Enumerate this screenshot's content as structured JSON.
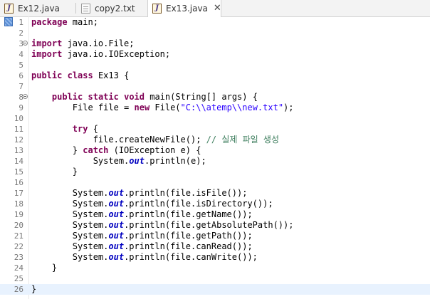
{
  "tabs": [
    {
      "label": "Ex12.java",
      "type": "java",
      "active": false
    },
    {
      "label": "copy2.txt",
      "type": "text",
      "active": false
    },
    {
      "label": "Ex13.java",
      "type": "java",
      "active": true
    }
  ],
  "close_glyph": "✕",
  "java_icon_glyph": "J",
  "code_lines": [
    {
      "n": "1",
      "tokens": [
        {
          "t": "kw",
          "v": "package"
        },
        {
          "t": "",
          "v": " main;"
        }
      ]
    },
    {
      "n": "2",
      "tokens": []
    },
    {
      "n": "3",
      "fold": true,
      "tokens": [
        {
          "t": "kw",
          "v": "import"
        },
        {
          "t": "",
          "v": " java.io.File;"
        }
      ]
    },
    {
      "n": "4",
      "tokens": [
        {
          "t": "kw",
          "v": "import"
        },
        {
          "t": "",
          "v": " java.io.IOException;"
        }
      ]
    },
    {
      "n": "5",
      "tokens": []
    },
    {
      "n": "6",
      "tokens": [
        {
          "t": "kw",
          "v": "public"
        },
        {
          "t": "",
          "v": " "
        },
        {
          "t": "kw",
          "v": "class"
        },
        {
          "t": "",
          "v": " Ex13 {"
        }
      ]
    },
    {
      "n": "7",
      "tokens": []
    },
    {
      "n": "8",
      "fold": true,
      "tokens": [
        {
          "t": "",
          "v": "    "
        },
        {
          "t": "kw",
          "v": "public"
        },
        {
          "t": "",
          "v": " "
        },
        {
          "t": "kw",
          "v": "static"
        },
        {
          "t": "",
          "v": " "
        },
        {
          "t": "kw",
          "v": "void"
        },
        {
          "t": "",
          "v": " main(String[] args) {"
        }
      ]
    },
    {
      "n": "9",
      "tokens": [
        {
          "t": "",
          "v": "        File file = "
        },
        {
          "t": "kw",
          "v": "new"
        },
        {
          "t": "",
          "v": " File("
        },
        {
          "t": "st",
          "v": "\"C:\\\\atemp\\\\new.txt\""
        },
        {
          "t": "",
          "v": ");"
        }
      ]
    },
    {
      "n": "10",
      "tokens": []
    },
    {
      "n": "11",
      "tokens": [
        {
          "t": "",
          "v": "        "
        },
        {
          "t": "kw",
          "v": "try"
        },
        {
          "t": "",
          "v": " {"
        }
      ]
    },
    {
      "n": "12",
      "tokens": [
        {
          "t": "",
          "v": "            file.createNewFile(); "
        },
        {
          "t": "cm",
          "v": "// 실제 파일 생성"
        }
      ]
    },
    {
      "n": "13",
      "tokens": [
        {
          "t": "",
          "v": "        } "
        },
        {
          "t": "kw",
          "v": "catch"
        },
        {
          "t": "",
          "v": " (IOException e) {"
        }
      ]
    },
    {
      "n": "14",
      "tokens": [
        {
          "t": "",
          "v": "            System."
        },
        {
          "t": "fd",
          "v": "out"
        },
        {
          "t": "",
          "v": ".println(e);"
        }
      ]
    },
    {
      "n": "15",
      "tokens": [
        {
          "t": "",
          "v": "        }"
        }
      ]
    },
    {
      "n": "16",
      "tokens": []
    },
    {
      "n": "17",
      "tokens": [
        {
          "t": "",
          "v": "        System."
        },
        {
          "t": "fd",
          "v": "out"
        },
        {
          "t": "",
          "v": ".println(file.isFile());"
        }
      ]
    },
    {
      "n": "18",
      "tokens": [
        {
          "t": "",
          "v": "        System."
        },
        {
          "t": "fd",
          "v": "out"
        },
        {
          "t": "",
          "v": ".println(file.isDirectory());"
        }
      ]
    },
    {
      "n": "19",
      "tokens": [
        {
          "t": "",
          "v": "        System."
        },
        {
          "t": "fd",
          "v": "out"
        },
        {
          "t": "",
          "v": ".println(file.getName());"
        }
      ]
    },
    {
      "n": "20",
      "tokens": [
        {
          "t": "",
          "v": "        System."
        },
        {
          "t": "fd",
          "v": "out"
        },
        {
          "t": "",
          "v": ".println(file.getAbsolutePath());"
        }
      ]
    },
    {
      "n": "21",
      "tokens": [
        {
          "t": "",
          "v": "        System."
        },
        {
          "t": "fd",
          "v": "out"
        },
        {
          "t": "",
          "v": ".println(file.getPath());"
        }
      ]
    },
    {
      "n": "22",
      "tokens": [
        {
          "t": "",
          "v": "        System."
        },
        {
          "t": "fd",
          "v": "out"
        },
        {
          "t": "",
          "v": ".println(file.canRead());"
        }
      ]
    },
    {
      "n": "23",
      "tokens": [
        {
          "t": "",
          "v": "        System."
        },
        {
          "t": "fd",
          "v": "out"
        },
        {
          "t": "",
          "v": ".println(file.canWrite());"
        }
      ]
    },
    {
      "n": "24",
      "tokens": [
        {
          "t": "",
          "v": "    }"
        }
      ]
    },
    {
      "n": "25",
      "tokens": []
    },
    {
      "n": "26",
      "tokens": [
        {
          "t": "",
          "v": "}"
        }
      ],
      "current": true
    }
  ]
}
